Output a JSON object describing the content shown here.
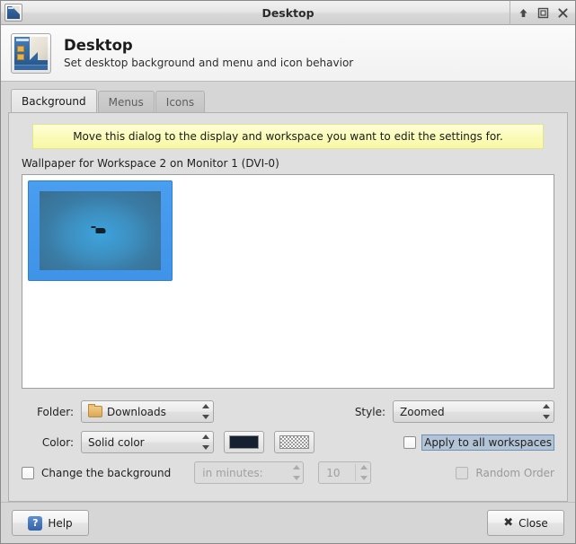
{
  "window": {
    "title": "Desktop",
    "icon": "desktop-preview-icon",
    "buttons": {
      "shade": "shade-icon",
      "maximize": "maximize-icon",
      "close": "close-icon"
    }
  },
  "header": {
    "icon": "desktop-preview-icon",
    "title": "Desktop",
    "subtitle": "Set desktop background and menu and icon behavior"
  },
  "tabs": [
    {
      "label": "Background",
      "active": true
    },
    {
      "label": "Menus",
      "active": false
    },
    {
      "label": "Icons",
      "active": false
    }
  ],
  "background_tab": {
    "notice": "Move this dialog to the display and workspace you want to edit the settings for.",
    "wallpaper_label": "Wallpaper for Workspace 2 on Monitor 1 (DVI-0)",
    "wallpaper_items": [
      {
        "name": "selected-wallpaper",
        "selected": true
      }
    ],
    "folder": {
      "label": "Folder:",
      "value": "Downloads",
      "icon": "folder-icon"
    },
    "style": {
      "label": "Style:",
      "value": "Zoomed"
    },
    "color": {
      "label": "Color:",
      "value": "Solid color",
      "swatch1": "#152030",
      "swatch2": "checkerboard-transparent"
    },
    "apply_all": {
      "label": "Apply to all workspaces",
      "checked": false,
      "focused": true
    },
    "change_background": {
      "label": "Change the background",
      "checked": false
    },
    "interval": {
      "placeholder": "in minutes:",
      "value": "in minutes:",
      "enabled": false
    },
    "interval_number": {
      "value": "10",
      "enabled": false
    },
    "random_order": {
      "label": "Random Order",
      "checked": false,
      "enabled": false
    }
  },
  "footer": {
    "help_label": "Help",
    "help_icon_glyph": "?",
    "close_label": "Close",
    "close_icon_glyph": "✖"
  }
}
